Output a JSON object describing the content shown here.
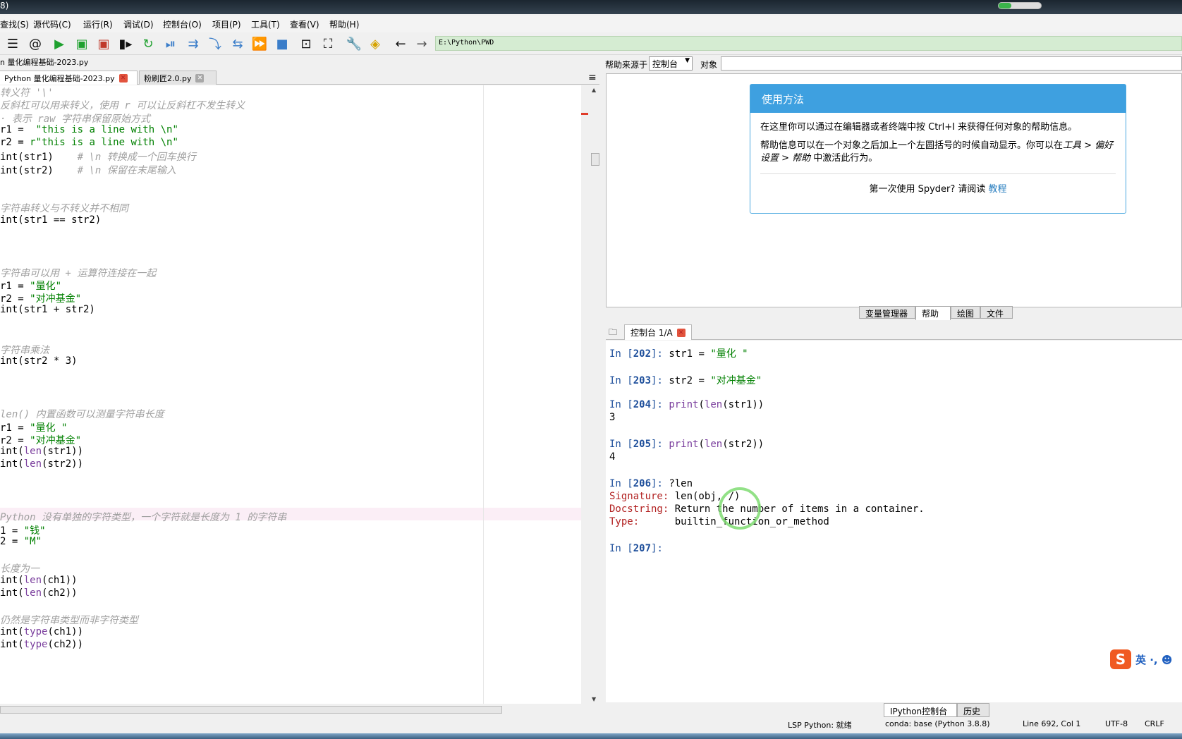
{
  "window": {
    "title_fragment": "8)",
    "progress": 0.3
  },
  "menu": [
    "查找(S)",
    "源代码(C)",
    "运行(R)",
    "调试(D)",
    "控制台(O)",
    "项目(P)",
    "工具(T)",
    "查看(V)",
    "帮助(H)"
  ],
  "toolbar": {
    "icons": [
      "list-icon",
      "at-icon",
      "run-icon",
      "run-cell-icon",
      "run-cell-advance-icon",
      "run-selection-icon",
      "rerun-icon",
      "debug-icon",
      "step-icon",
      "step-into-icon",
      "step-return-icon",
      "continue-icon",
      "stop-icon",
      "maximize-pane-icon",
      "fullscreen-icon",
      "preferences-icon",
      "python-path-icon",
      "back-icon",
      "forward-icon"
    ],
    "path": "E:\\Python\\PWD"
  },
  "editor": {
    "file_path": "n 量化编程基础-2023.py",
    "tabs": [
      {
        "label": "Python 量化编程基础-2023.py",
        "active": true
      },
      {
        "label": "粉刷匠2.0.py",
        "active": false
      }
    ],
    "lines": [
      [
        {
          "t": "转义符 '\\'",
          "c": "comment"
        }
      ],
      [
        {
          "t": "反斜杠可以用来转义，使用 r 可以让反斜杠不发生转义",
          "c": "comment"
        }
      ],
      [
        {
          "t": "· 表示 raw 字符串保留原始方式",
          "c": "comment"
        }
      ],
      [
        {
          "t": "r1 = ",
          "c": ""
        },
        {
          "t": " \"this is a line with \\n\"",
          "c": "str"
        }
      ],
      [
        {
          "t": "r2 = ",
          "c": ""
        },
        {
          "t": "r\"this is a line with \\n\"",
          "c": "str"
        }
      ],
      [
        {
          "t": "int(str1)    ",
          "c": ""
        },
        {
          "t": "# \\n 转换成一个回车换行",
          "c": "comment"
        }
      ],
      [
        {
          "t": "int(str2)    ",
          "c": ""
        },
        {
          "t": "# \\n 保留在末尾输入",
          "c": "comment"
        }
      ],
      [],
      [],
      [
        {
          "t": "字符串转义与不转义并不相同",
          "c": "comment"
        }
      ],
      [
        {
          "t": "int(str1 == str2)",
          "c": ""
        }
      ],
      [],
      [],
      [],
      [
        {
          "t": "字符串可以用 + 运算符连接在一起",
          "c": "comment"
        }
      ],
      [
        {
          "t": "r1 = ",
          "c": ""
        },
        {
          "t": "\"量化\"",
          "c": "str"
        }
      ],
      [
        {
          "t": "r2 = ",
          "c": ""
        },
        {
          "t": "\"对冲基金\"",
          "c": "str"
        }
      ],
      [
        {
          "t": "int(str1 + str2)",
          "c": ""
        }
      ],
      [],
      [],
      [
        {
          "t": "字符串乘法",
          "c": "comment"
        }
      ],
      [
        {
          "t": "int(str2 * 3)",
          "c": ""
        }
      ],
      [],
      [],
      [],
      [
        {
          "t": "len() 内置函数可以测量字符串长度",
          "c": "comment"
        }
      ],
      [
        {
          "t": "r1 = ",
          "c": ""
        },
        {
          "t": "\"量化 \"",
          "c": "str"
        }
      ],
      [
        {
          "t": "r2 = ",
          "c": ""
        },
        {
          "t": "\"对冲基金\"",
          "c": "str"
        }
      ],
      [
        {
          "t": "int(",
          "c": ""
        },
        {
          "t": "len",
          "c": "kw"
        },
        {
          "t": "(str1))",
          "c": ""
        }
      ],
      [
        {
          "t": "int(",
          "c": ""
        },
        {
          "t": "len",
          "c": "kw"
        },
        {
          "t": "(str2))",
          "c": ""
        }
      ],
      [],
      [],
      [],
      [
        {
          "t": "Python 没有单独的字符类型，一个字符就是长度为 1 的字符串",
          "c": "comment"
        }
      ],
      [
        {
          "t": "1 = ",
          "c": ""
        },
        {
          "t": "\"钱\"",
          "c": "str"
        }
      ],
      [
        {
          "t": "2 = ",
          "c": ""
        },
        {
          "t": "\"M\"",
          "c": "str"
        }
      ],
      [],
      [
        {
          "t": "长度为一",
          "c": "comment"
        }
      ],
      [
        {
          "t": "int(",
          "c": ""
        },
        {
          "t": "len",
          "c": "kw"
        },
        {
          "t": "(ch1))",
          "c": ""
        }
      ],
      [
        {
          "t": "int(",
          "c": ""
        },
        {
          "t": "len",
          "c": "kw"
        },
        {
          "t": "(ch2))",
          "c": ""
        }
      ],
      [],
      [
        {
          "t": "仍然是字符串类型而非字符类型",
          "c": "comment"
        }
      ],
      [
        {
          "t": "int(",
          "c": ""
        },
        {
          "t": "type",
          "c": "kw"
        },
        {
          "t": "(ch1))",
          "c": ""
        }
      ],
      [
        {
          "t": "int(",
          "c": ""
        },
        {
          "t": "type",
          "c": "kw"
        },
        {
          "t": "(ch2))",
          "c": ""
        }
      ]
    ]
  },
  "help": {
    "source_label": "帮助来源于",
    "source_value": "控制台",
    "object_label": "对象",
    "card_title": "使用方法",
    "p1": "在这里你可以通过在编辑器或者终端中按 Ctrl+I 来获得任何对象的帮助信息。",
    "p2a": "帮助信息可以在一个对象之后加上一个左圆括号的时候自动显示。你可以在",
    "p2b": "工具 > 偏好设置 > 帮助",
    "p2c": " 中激活此行为。",
    "foot_text": "第一次使用 Spyder? 请阅读 ",
    "foot_link": "教程"
  },
  "pane_tabs": [
    "变量管理器",
    "帮助",
    "绘图",
    "文件"
  ],
  "console": {
    "tab_label": "控制台 1/A",
    "lines": [
      {
        "type": "in",
        "n": "202",
        "code": [
          {
            "t": "str1 = ",
            "c": ""
          },
          {
            "t": "\"量化 \"",
            "c": "str"
          }
        ]
      },
      {
        "type": "blank"
      },
      {
        "type": "in",
        "n": "203",
        "code": [
          {
            "t": "str2 = ",
            "c": ""
          },
          {
            "t": "\"对冲基金\"",
            "c": "str"
          }
        ]
      },
      {
        "type": "blank"
      },
      {
        "type": "in",
        "n": "204",
        "code": [
          {
            "t": "print",
            "c": "kw"
          },
          {
            "t": "(",
            "c": ""
          },
          {
            "t": "len",
            "c": "kw"
          },
          {
            "t": "(str1))",
            "c": ""
          }
        ]
      },
      {
        "type": "out",
        "text": "3"
      },
      {
        "type": "blank"
      },
      {
        "type": "in",
        "n": "205",
        "code": [
          {
            "t": "print",
            "c": "kw"
          },
          {
            "t": "(",
            "c": ""
          },
          {
            "t": "len",
            "c": "kw"
          },
          {
            "t": "(str2))",
            "c": ""
          }
        ]
      },
      {
        "type": "out",
        "text": "4"
      },
      {
        "type": "blank"
      },
      {
        "type": "in",
        "n": "206",
        "code": [
          {
            "t": "?len",
            "c": ""
          }
        ]
      },
      {
        "type": "info",
        "key": "Signature: ",
        "val": "len(obj, /)"
      },
      {
        "type": "info",
        "key": "Docstring: ",
        "val": "Return the number of items in a container."
      },
      {
        "type": "info",
        "key": "Type:      ",
        "val": "builtin_function_or_method"
      },
      {
        "type": "blank"
      },
      {
        "type": "in",
        "n": "207",
        "code": []
      }
    ]
  },
  "bottom_tabs": [
    "IPython控制台",
    "历史"
  ],
  "status": {
    "lsp": "LSP Python: 就绪",
    "conda": "conda: base (Python 3.8.8)",
    "position": "Line 692, Col 1",
    "encoding": "UTF-8",
    "eol": "CRLF"
  },
  "ime": {
    "label": "英 ·, ☻"
  }
}
